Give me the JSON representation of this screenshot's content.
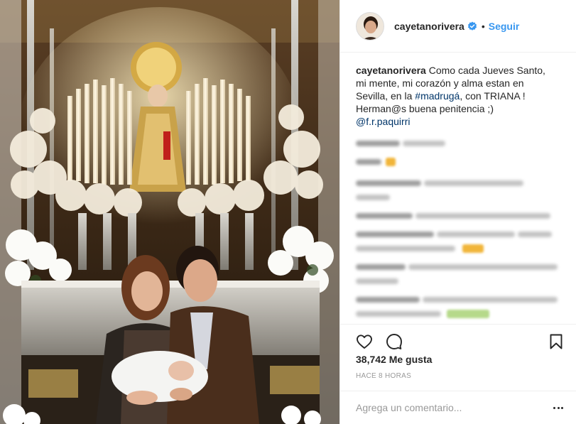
{
  "post": {
    "username": "cayetanorivera",
    "follow_label": "Seguir",
    "separator": "•",
    "caption": {
      "username": "cayetanorivera",
      "line1": "Como cada Jueves Santo,",
      "line2": "mi mente, mi corazón y alma estan en",
      "line3_prefix": "Sevilla, en la ",
      "hashtag": "#madrugá",
      "line3_suffix": ", con TRIANA !",
      "line4": "Herman@s buena penitencia ;)",
      "mention": "@f.r.paquirri"
    },
    "likes_text": "38,742 Me gusta",
    "time_text": "HACE 8 HORAS",
    "comment_placeholder": "Agrega un comentario..."
  },
  "colors": {
    "accent": "#3897f0",
    "link": "#003569",
    "text": "#262626",
    "muted": "#999999",
    "border": "#efefef"
  },
  "icons": {
    "verified": "verified-badge-icon",
    "like": "heart-icon",
    "comment": "comment-bubble-icon",
    "save": "bookmark-icon",
    "options": "more-options-icon"
  }
}
